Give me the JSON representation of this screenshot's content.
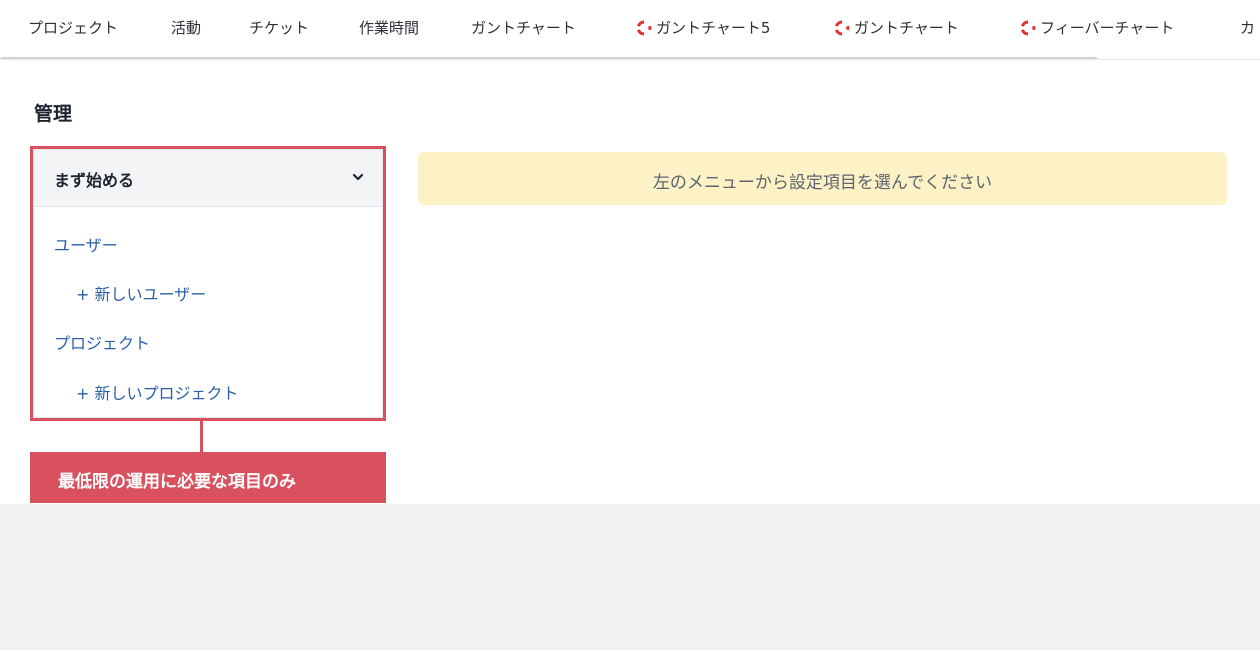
{
  "tabs": [
    {
      "label": "プロジェクト",
      "icon": null
    },
    {
      "label": "活動",
      "icon": null
    },
    {
      "label": "チケット",
      "icon": null
    },
    {
      "label": "作業時間",
      "icon": null
    },
    {
      "label": "ガントチャート",
      "icon": null
    },
    {
      "label": "ガントチャート5",
      "icon": "gantt-plugin-icon"
    },
    {
      "label": "ガントチャート",
      "icon": "gantt-plugin-icon"
    },
    {
      "label": "フィーバーチャート",
      "icon": "gantt-plugin-icon"
    },
    {
      "label": "カ",
      "icon": null
    }
  ],
  "page": {
    "title": "管理"
  },
  "menu": {
    "header": "まず始める",
    "items": [
      {
        "label": "ユーザー"
      },
      {
        "label": "+ 新しいユーザー"
      },
      {
        "label": "プロジェクト"
      },
      {
        "label": "+ 新しいプロジェクト"
      }
    ]
  },
  "notice": "左のメニューから設定項目を選んでください",
  "callout": "最低限の運用に必要な項目のみ",
  "colors": {
    "accent_red": "#d9505f",
    "link_blue": "#2a5fa8",
    "notice_bg": "#fdf2c5",
    "icon_red": "#e02f2f"
  }
}
